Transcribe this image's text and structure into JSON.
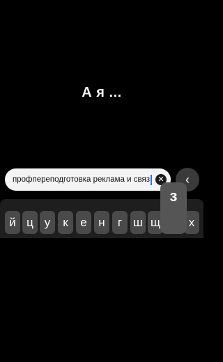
{
  "headline": "А я ...",
  "search": {
    "value": "профпереподготовка реклама и связ",
    "clear_icon": "✕",
    "close_icon": "‹"
  },
  "keyboard": {
    "row1": [
      "й",
      "ц",
      "у",
      "к",
      "е",
      "н",
      "г",
      "ш",
      "щ",
      "з",
      "х"
    ],
    "popup_key": "з"
  }
}
